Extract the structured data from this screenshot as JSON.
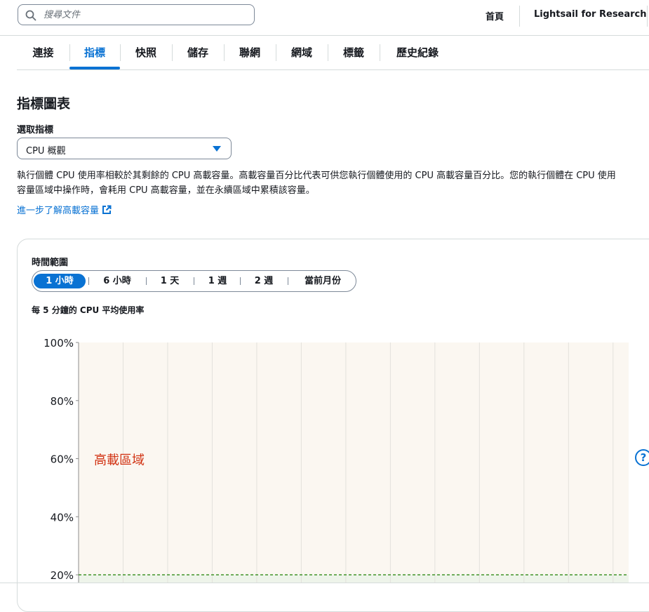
{
  "header": {
    "search_placeholder": "搜尋文件",
    "home": "首頁",
    "product": "Lightsail for Research"
  },
  "tabs": [
    "連接",
    "指標",
    "快照",
    "儲存",
    "聯網",
    "網域",
    "標籤",
    "歷史紀錄"
  ],
  "active_tab": "指標",
  "section": {
    "title": "指標圖表",
    "select_label": "選取指標",
    "select_value": "CPU 概觀",
    "description_line1": "執行個體 CPU 使用率相較於其剩餘的 CPU 高載容量。高載容量百分比代表可供您執行個體使用的 CPU 高載容量百分比。您的執行個體在 CPU 使用",
    "description_line2": "容量區域中操作時，會耗用 CPU 高載容量，並在永續區域中累積該容量。",
    "learn_more": "進一步了解高載容量"
  },
  "time_range": {
    "label": "時間範圍",
    "options": [
      "1 小時",
      "6 小時",
      "1 天",
      "1 週",
      "2 週",
      "當前月份"
    ],
    "selected": "1 小時"
  },
  "chart_title": "每 5 分鐘的 CPU 平均使用率",
  "help_glyph": "?",
  "colors": {
    "accent": "#0972d3",
    "burst_zone_bg": "#fbf7f1",
    "burst_zone_label": "#d13212",
    "sustainable_line": "#1d8102",
    "sustainable_bg": "#eef4ea"
  },
  "chart_data": {
    "type": "line",
    "title": "每 5 分鐘的 CPU 平均使用率",
    "ylim": [
      20,
      100
    ],
    "yticks": [
      100,
      80,
      60,
      40,
      20
    ],
    "ytick_labels": [
      "100%",
      "80%",
      "60%",
      "40%",
      "20%"
    ],
    "series": [],
    "zones": [
      {
        "label": "高載區域",
        "from": 20,
        "to": 100
      }
    ],
    "threshold": {
      "value": 20,
      "style": "dashed"
    },
    "grid": true
  }
}
